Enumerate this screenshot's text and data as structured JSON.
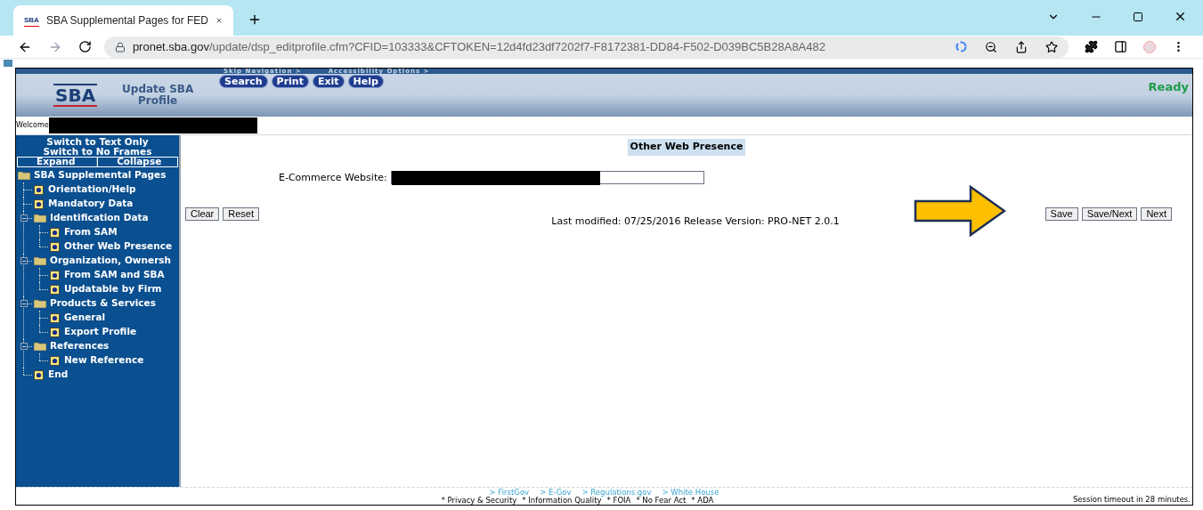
{
  "browser": {
    "favicon": "SBA",
    "tab_title": "SBA Supplemental Pages for FED",
    "url_host": "pronet.sba.gov",
    "url_path": "/update/dsp_editprofile.cfm?CFID=103333&CFTOKEN=12d4fd23df7202f7-F8172381-DD84-F502-D039BC5B28A8A482"
  },
  "header": {
    "skip_links": [
      "Skip Navigation >",
      "Accessibility Options >"
    ],
    "logo": "SBA",
    "title": "Update SBA Profile",
    "nav_buttons": [
      "Search",
      "Print",
      "Exit",
      "Help"
    ],
    "status": "Ready",
    "welcome": "Welcome"
  },
  "sidebar": {
    "links": [
      "Switch to Text Only",
      "Switch to No Frames"
    ],
    "toggles": [
      "Expand",
      "|",
      "Collapse"
    ],
    "tree": [
      {
        "label": "SBA Supplemental Pages",
        "kind": "folder",
        "children": [
          {
            "label": "Orientation/Help",
            "kind": "page"
          },
          {
            "label": "Mandatory Data",
            "kind": "page"
          },
          {
            "label": "Identification Data",
            "kind": "folder",
            "expanded": true,
            "children": [
              {
                "label": "From SAM",
                "kind": "page"
              },
              {
                "label": "Other Web Presence",
                "kind": "page"
              }
            ]
          },
          {
            "label": "Organization, Ownersh",
            "kind": "folder",
            "expanded": true,
            "children": [
              {
                "label": "From SAM and SBA",
                "kind": "page"
              },
              {
                "label": "Updatable by Firm",
                "kind": "page"
              }
            ]
          },
          {
            "label": "Products & Services",
            "kind": "folder",
            "expanded": true,
            "children": [
              {
                "label": "General",
                "kind": "page"
              },
              {
                "label": "Export Profile",
                "kind": "page"
              }
            ]
          },
          {
            "label": "References",
            "kind": "folder",
            "expanded": true,
            "children": [
              {
                "label": "New Reference",
                "kind": "page"
              }
            ]
          },
          {
            "label": "End",
            "kind": "page"
          }
        ]
      }
    ]
  },
  "content": {
    "heading": "Other Web Presence",
    "field_label": "E-Commerce Website:",
    "left_buttons": [
      "Clear",
      "Reset"
    ],
    "right_buttons": [
      "Save",
      "Save/Next",
      "Next"
    ],
    "last_modified": "Last modified: 07/25/2016 Release Version: PRO-NET 2.0.1"
  },
  "footer": {
    "links": [
      "> FirstGov",
      "> E-Gov",
      "> Regulations.gov",
      "> White House"
    ],
    "policies": [
      "* Privacy & Security",
      "* Information Quality",
      "* FOIA",
      "* No Fear Act",
      "* ADA"
    ],
    "session": "Session timeout in 28 minutes."
  }
}
